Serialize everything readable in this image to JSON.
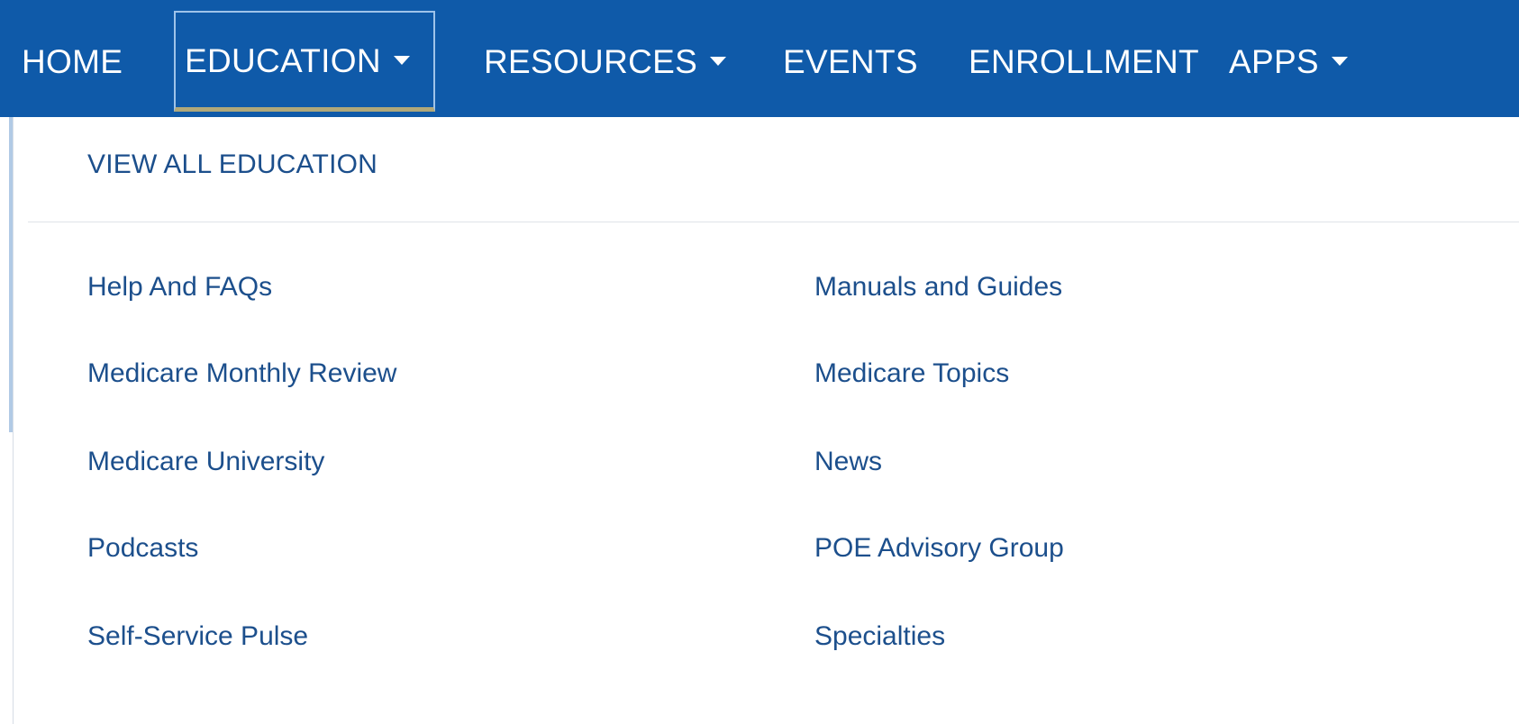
{
  "nav": {
    "items": [
      {
        "label": "HOME",
        "has_dropdown": false
      },
      {
        "label": "EDUCATION",
        "has_dropdown": true,
        "active": true
      },
      {
        "label": "RESOURCES",
        "has_dropdown": true
      },
      {
        "label": "EVENTS",
        "has_dropdown": false
      },
      {
        "label": "ENROLLMENT",
        "has_dropdown": false
      },
      {
        "label": "APPS",
        "has_dropdown": true
      }
    ]
  },
  "dropdown": {
    "view_all_label": "VIEW ALL EDUCATION",
    "left_column": [
      "Help And FAQs",
      "Medicare Monthly Review",
      "Medicare University",
      "Podcasts",
      "Self-Service Pulse"
    ],
    "right_column": [
      "Manuals and Guides",
      "Medicare Topics",
      "News",
      "POE Advisory Group",
      "Specialties"
    ]
  },
  "colors": {
    "nav_background": "#0f5aa9",
    "link_text": "#1c4f8c",
    "active_underline": "#b0a87a"
  },
  "icons": {
    "dropdown_caret": "caret-down-icon"
  }
}
